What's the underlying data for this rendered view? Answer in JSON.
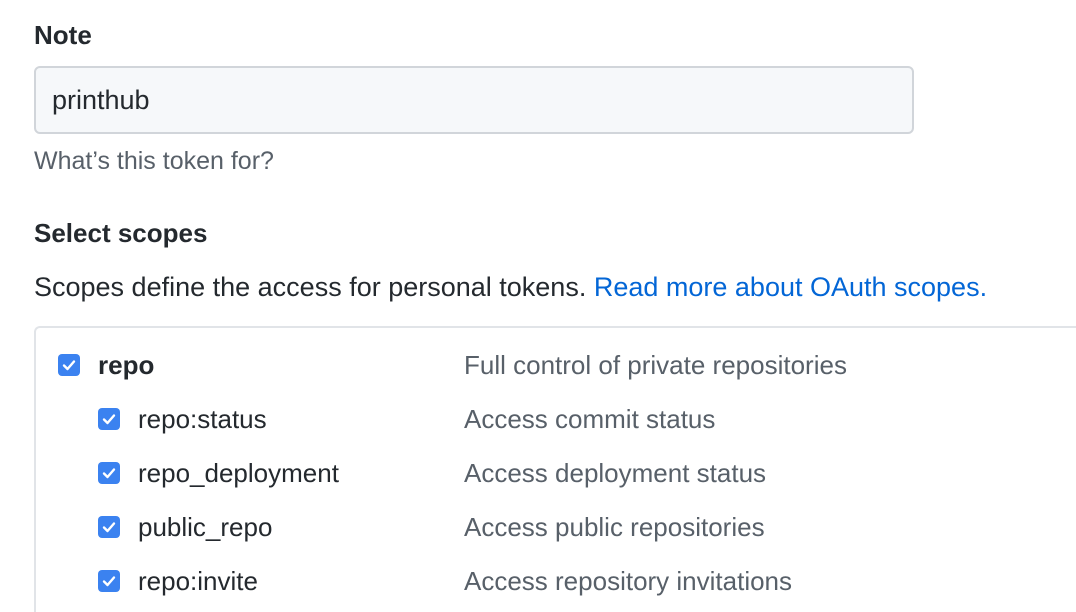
{
  "note": {
    "label": "Note",
    "value": "printhub",
    "hint": "What’s this token for?"
  },
  "scopes": {
    "heading": "Select scopes",
    "description": "Scopes define the access for personal tokens.",
    "link_text": "Read more about OAuth scopes.",
    "items": [
      {
        "name": "repo",
        "description": "Full control of private repositories",
        "checked": true
      },
      {
        "name": "repo:status",
        "description": "Access commit status",
        "checked": true
      },
      {
        "name": "repo_deployment",
        "description": "Access deployment status",
        "checked": true
      },
      {
        "name": "public_repo",
        "description": "Access public repositories",
        "checked": true
      },
      {
        "name": "repo:invite",
        "description": "Access repository invitations",
        "checked": true
      }
    ]
  },
  "colors": {
    "checkbox": "#3b82f0",
    "link": "#0366d6"
  }
}
